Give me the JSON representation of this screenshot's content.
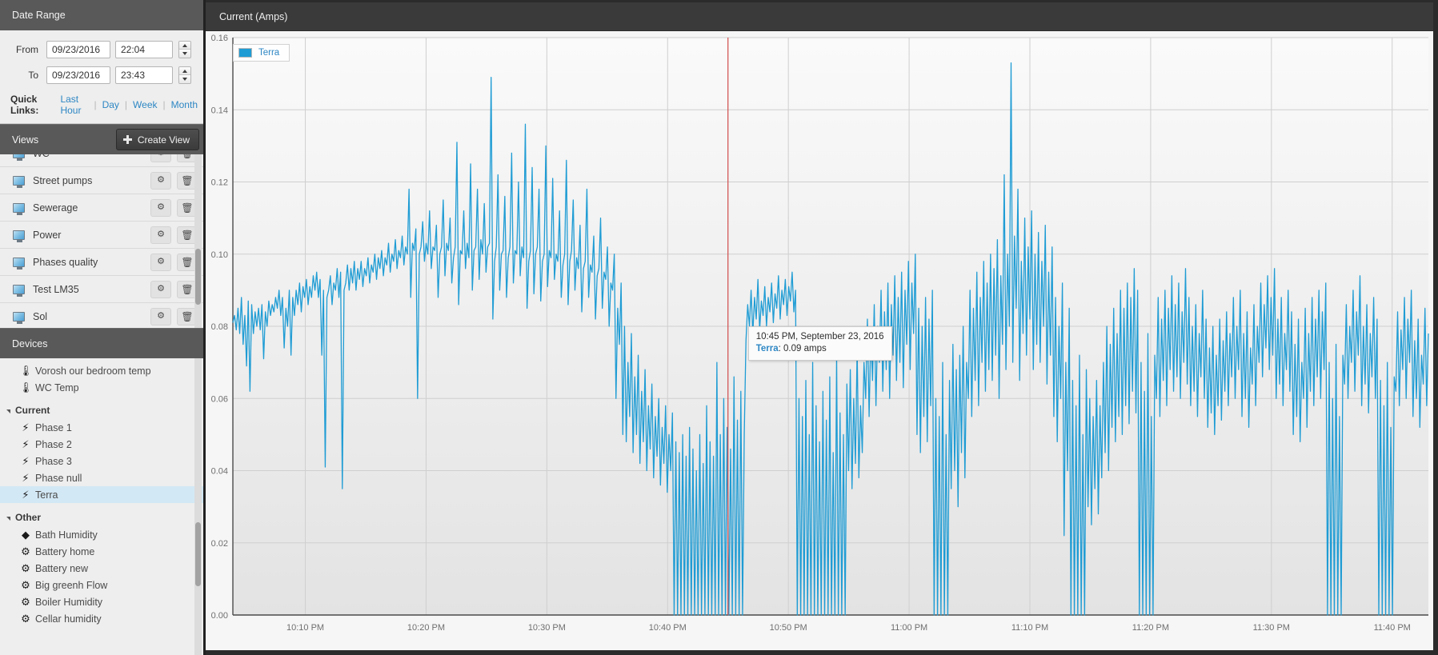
{
  "date_range": {
    "title": "Date Range",
    "from_label": "From",
    "to_label": "To",
    "from_date": "09/23/2016",
    "from_time": "22:04",
    "to_date": "09/23/2016",
    "to_time": "23:43",
    "quick_links_label": "Quick Links:",
    "quick_links": [
      "Last Hour",
      "Day",
      "Week",
      "Month"
    ]
  },
  "views": {
    "title": "Views",
    "create_button": "Create View",
    "create_icon": "plus-icon",
    "items": [
      {
        "name": "WC",
        "icon": "monitor-icon"
      },
      {
        "name": "Street pumps",
        "icon": "monitor-icon"
      },
      {
        "name": "Sewerage",
        "icon": "monitor-icon"
      },
      {
        "name": "Power",
        "icon": "monitor-icon"
      },
      {
        "name": "Phases quality",
        "icon": "monitor-icon"
      },
      {
        "name": "Test LM35",
        "icon": "monitor-icon"
      },
      {
        "name": "Sol",
        "icon": "monitor-icon"
      }
    ],
    "row_settings_icon": "gear-icon",
    "row_delete_icon": "trash-icon"
  },
  "devices": {
    "title": "Devices",
    "nodes": [
      {
        "type": "device",
        "label": "Vorosh our bedroom temp",
        "icon": "thermometer-icon",
        "glyph": "🌡",
        "selected": false
      },
      {
        "type": "device",
        "label": "WC Temp",
        "icon": "thermometer-icon",
        "glyph": "🌡",
        "selected": false
      },
      {
        "type": "group",
        "label": "Current",
        "icon": "collapse-triangle-icon"
      },
      {
        "type": "device",
        "label": "Phase 1",
        "icon": "bolt-icon",
        "glyph": "⚡",
        "selected": false
      },
      {
        "type": "device",
        "label": "Phase 2",
        "icon": "bolt-icon",
        "glyph": "⚡",
        "selected": false
      },
      {
        "type": "device",
        "label": "Phase 3",
        "icon": "bolt-icon",
        "glyph": "⚡",
        "selected": false
      },
      {
        "type": "device",
        "label": "Phase null",
        "icon": "bolt-icon",
        "glyph": "⚡",
        "selected": false
      },
      {
        "type": "device",
        "label": "Terra",
        "icon": "bolt-icon",
        "glyph": "⚡",
        "selected": true
      },
      {
        "type": "group",
        "label": "Other",
        "icon": "collapse-triangle-icon"
      },
      {
        "type": "device",
        "label": "Bath Humidity",
        "icon": "droplet-icon",
        "glyph": "◆",
        "selected": false
      },
      {
        "type": "device",
        "label": "Battery home",
        "icon": "gear-icon",
        "glyph": "⚙",
        "selected": false
      },
      {
        "type": "device",
        "label": "Battery new",
        "icon": "gear-icon",
        "glyph": "⚙",
        "selected": false
      },
      {
        "type": "device",
        "label": "Big greenh Flow",
        "icon": "gear-icon",
        "glyph": "⚙",
        "selected": false
      },
      {
        "type": "device",
        "label": "Boiler Humidity",
        "icon": "gear-icon",
        "glyph": "⚙",
        "selected": false
      },
      {
        "type": "device",
        "label": "Cellar humidity",
        "icon": "gear-icon",
        "glyph": "⚙",
        "selected": false
      }
    ]
  },
  "chart_panel": {
    "title": "Current (Amps)"
  },
  "tooltip": {
    "time": "10:45 PM, September 23, 2016",
    "series_name": "Terra",
    "value_text": ": 0.09 amps"
  },
  "chart_data": {
    "type": "line",
    "title": "Current (Amps)",
    "xlabel": "",
    "ylabel": "Current (Amps)",
    "grid": true,
    "legend_position": "top-left",
    "legend": [
      "Terra"
    ],
    "colors": {
      "series": "#1f9cd4",
      "cursor_line": "#d24b4b",
      "grid": "#cfcfcf"
    },
    "ylim": [
      0.0,
      0.16
    ],
    "yticks": [
      0.0,
      0.02,
      0.04,
      0.06,
      0.08,
      0.1,
      0.12,
      0.14,
      0.16
    ],
    "ytick_labels": [
      "0.00",
      "0.02",
      "0.04",
      "0.06",
      "0.08",
      "0.10",
      "0.12",
      "0.14",
      "0.16"
    ],
    "xlim_minutes": [
      1324,
      1423
    ],
    "xticks_minutes": [
      1330,
      1340,
      1350,
      1360,
      1370,
      1380,
      1390,
      1400,
      1410,
      1420
    ],
    "xtick_labels": [
      "10:10 PM",
      "10:20 PM",
      "10:30 PM",
      "10:40 PM",
      "10:50 PM",
      "11:00 PM",
      "11:10 PM",
      "11:20 PM",
      "11:30 PM",
      "11:40 PM"
    ],
    "cursor_minute": 1365,
    "highlight_point": {
      "minute": 1365,
      "value": 0.09
    },
    "series": [
      {
        "name": "Terra",
        "unit": "amps",
        "color": "#1f9cd4",
        "values": [
          0.081,
          0.083,
          0.079,
          0.085,
          0.078,
          0.088,
          0.075,
          0.083,
          0.069,
          0.087,
          0.062,
          0.086,
          0.078,
          0.084,
          0.08,
          0.085,
          0.079,
          0.086,
          0.071,
          0.084,
          0.08,
          0.087,
          0.083,
          0.086,
          0.084,
          0.088,
          0.085,
          0.09,
          0.083,
          0.088,
          0.074,
          0.085,
          0.08,
          0.09,
          0.072,
          0.088,
          0.083,
          0.09,
          0.086,
          0.092,
          0.084,
          0.091,
          0.088,
          0.093,
          0.086,
          0.091,
          0.088,
          0.094,
          0.09,
          0.095,
          0.088,
          0.093,
          0.072,
          0.09,
          0.041,
          0.088,
          0.09,
          0.094,
          0.086,
          0.092,
          0.09,
          0.096,
          0.088,
          0.095,
          0.035,
          0.09,
          0.092,
          0.097,
          0.09,
          0.096,
          0.092,
          0.098,
          0.09,
          0.096,
          0.093,
          0.098,
          0.091,
          0.096,
          0.094,
          0.099,
          0.092,
          0.097,
          0.095,
          0.1,
          0.093,
          0.099,
          0.096,
          0.101,
          0.094,
          0.099,
          0.097,
          0.103,
          0.095,
          0.1,
          0.098,
          0.104,
          0.096,
          0.101,
          0.099,
          0.105,
          0.097,
          0.102,
          0.1,
          0.118,
          0.088,
          0.103,
          0.101,
          0.107,
          0.06,
          0.1,
          0.102,
          0.109,
          0.098,
          0.103,
          0.1,
          0.112,
          0.096,
          0.102,
          0.101,
          0.108,
          0.088,
          0.1,
          0.102,
          0.115,
          0.094,
          0.103,
          0.101,
          0.11,
          0.092,
          0.099,
          0.102,
          0.131,
          0.086,
          0.101,
          0.1,
          0.112,
          0.096,
          0.103,
          0.099,
          0.125,
          0.09,
          0.101,
          0.102,
          0.118,
          0.093,
          0.104,
          0.1,
          0.114,
          0.095,
          0.102,
          0.103,
          0.149,
          0.082,
          0.098,
          0.102,
          0.122,
          0.09,
          0.1,
          0.101,
          0.116,
          0.088,
          0.099,
          0.102,
          0.128,
          0.092,
          0.101,
          0.1,
          0.12,
          0.094,
          0.102,
          0.099,
          0.136,
          0.085,
          0.098,
          0.101,
          0.124,
          0.089,
          0.1,
          0.102,
          0.118,
          0.087,
          0.098,
          0.1,
          0.13,
          0.091,
          0.101,
          0.099,
          0.121,
          0.093,
          0.1,
          0.098,
          0.112,
          0.088,
          0.097,
          0.1,
          0.126,
          0.086,
          0.098,
          0.101,
          0.115,
          0.09,
          0.099,
          0.096,
          0.108,
          0.084,
          0.096,
          0.098,
          0.118,
          0.088,
          0.097,
          0.095,
          0.105,
          0.082,
          0.094,
          0.096,
          0.11,
          0.085,
          0.095,
          0.093,
          0.102,
          0.08,
          0.092,
          0.09,
          0.1,
          0.06,
          0.085,
          0.075,
          0.092,
          0.05,
          0.08,
          0.048,
          0.07,
          0.055,
          0.078,
          0.045,
          0.066,
          0.05,
          0.072,
          0.042,
          0.062,
          0.048,
          0.068,
          0.04,
          0.058,
          0.046,
          0.064,
          0.038,
          0.055,
          0.044,
          0.06,
          0.036,
          0.052,
          0.042,
          0.058,
          0.034,
          0.05,
          0.04,
          0.056,
          0.0,
          0.048,
          0.0,
          0.045,
          0.0,
          0.05,
          0.0,
          0.044,
          0.0,
          0.052,
          0.0,
          0.046,
          0.0,
          0.04,
          0.0,
          0.05,
          0.0,
          0.042,
          0.0,
          0.058,
          0.0,
          0.048,
          0.0,
          0.044,
          0.0,
          0.07,
          0.0,
          0.05,
          0.0,
          0.06,
          0.0,
          0.052,
          0.0,
          0.046,
          0.0,
          0.066,
          0.0,
          0.054,
          0.0,
          0.062,
          0.0,
          0.05,
          0.076,
          0.086,
          0.08,
          0.09,
          0.078,
          0.088,
          0.082,
          0.093,
          0.079,
          0.087,
          0.083,
          0.091,
          0.08,
          0.088,
          0.084,
          0.092,
          0.081,
          0.089,
          0.085,
          0.094,
          0.082,
          0.09,
          0.086,
          0.093,
          0.083,
          0.091,
          0.087,
          0.095,
          0.084,
          0.09,
          0.0,
          0.06,
          0.0,
          0.055,
          0.0,
          0.065,
          0.0,
          0.05,
          0.0,
          0.07,
          0.0,
          0.058,
          0.0,
          0.048,
          0.0,
          0.062,
          0.0,
          0.054,
          0.0,
          0.066,
          0.0,
          0.045,
          0.0,
          0.072,
          0.0,
          0.056,
          0.0,
          0.05,
          0.0,
          0.064,
          0.04,
          0.068,
          0.035,
          0.06,
          0.042,
          0.074,
          0.038,
          0.058,
          0.045,
          0.07,
          0.06,
          0.082,
          0.055,
          0.078,
          0.065,
          0.086,
          0.058,
          0.08,
          0.07,
          0.09,
          0.062,
          0.084,
          0.068,
          0.092,
          0.06,
          0.086,
          0.072,
          0.094,
          0.065,
          0.088,
          0.07,
          0.095,
          0.063,
          0.09,
          0.075,
          0.098,
          0.068,
          0.092,
          0.078,
          0.1,
          0.05,
          0.085,
          0.045,
          0.08,
          0.055,
          0.088,
          0.048,
          0.082,
          0.058,
          0.09,
          0.0,
          0.06,
          0.0,
          0.055,
          0.0,
          0.07,
          0.0,
          0.05,
          0.0,
          0.065,
          0.035,
          0.075,
          0.04,
          0.068,
          0.03,
          0.072,
          0.045,
          0.08,
          0.038,
          0.07,
          0.06,
          0.09,
          0.055,
          0.085,
          0.065,
          0.095,
          0.058,
          0.088,
          0.07,
          0.098,
          0.062,
          0.092,
          0.068,
          0.1,
          0.065,
          0.096,
          0.072,
          0.104,
          0.06,
          0.094,
          0.075,
          0.122,
          0.068,
          0.1,
          0.08,
          0.153,
          0.07,
          0.105,
          0.085,
          0.118,
          0.065,
          0.098,
          0.078,
          0.11,
          0.072,
          0.102,
          0.082,
          0.112,
          0.068,
          0.1,
          0.075,
          0.106,
          0.07,
          0.098,
          0.08,
          0.108,
          0.064,
          0.095,
          0.072,
          0.102,
          0.055,
          0.088,
          0.048,
          0.08,
          0.06,
          0.092,
          0.022,
          0.07,
          0.04,
          0.085,
          0.0,
          0.065,
          0.0,
          0.058,
          0.0,
          0.072,
          0.0,
          0.05,
          0.0,
          0.068,
          0.03,
          0.06,
          0.025,
          0.055,
          0.035,
          0.065,
          0.028,
          0.058,
          0.038,
          0.07,
          0.045,
          0.08,
          0.04,
          0.075,
          0.052,
          0.085,
          0.048,
          0.078,
          0.055,
          0.09,
          0.05,
          0.085,
          0.058,
          0.092,
          0.053,
          0.088,
          0.062,
          0.096,
          0.056,
          0.09,
          0.0,
          0.07,
          0.0,
          0.062,
          0.0,
          0.078,
          0.0,
          0.055,
          0.0,
          0.072,
          0.06,
          0.088,
          0.055,
          0.082,
          0.065,
          0.09,
          0.058,
          0.085,
          0.068,
          0.094,
          0.062,
          0.086,
          0.066,
          0.092,
          0.06,
          0.084,
          0.07,
          0.096,
          0.064,
          0.088,
          0.058,
          0.08,
          0.062,
          0.086,
          0.055,
          0.078,
          0.066,
          0.09,
          0.06,
          0.082,
          0.052,
          0.074,
          0.056,
          0.08,
          0.05,
          0.072,
          0.058,
          0.082,
          0.054,
          0.076,
          0.062,
          0.084,
          0.058,
          0.078,
          0.066,
          0.088,
          0.06,
          0.08,
          0.068,
          0.09,
          0.055,
          0.078,
          0.06,
          0.084,
          0.052,
          0.074,
          0.064,
          0.086,
          0.058,
          0.08,
          0.07,
          0.092,
          0.066,
          0.086,
          0.074,
          0.094,
          0.068,
          0.088,
          0.072,
          0.096,
          0.06,
          0.082,
          0.064,
          0.088,
          0.058,
          0.078,
          0.068,
          0.09,
          0.062,
          0.084,
          0.05,
          0.075,
          0.055,
          0.082,
          0.048,
          0.07,
          0.06,
          0.085,
          0.052,
          0.078,
          0.062,
          0.088,
          0.058,
          0.082,
          0.066,
          0.09,
          0.06,
          0.084,
          0.068,
          0.092,
          0.0,
          0.07,
          0.0,
          0.06,
          0.0,
          0.075,
          0.0,
          0.055,
          0.0,
          0.072,
          0.064,
          0.086,
          0.06,
          0.08,
          0.07,
          0.09,
          0.062,
          0.084,
          0.072,
          0.094,
          0.058,
          0.08,
          0.064,
          0.086,
          0.056,
          0.078,
          0.066,
          0.088,
          0.06,
          0.082,
          0.0,
          0.065,
          0.0,
          0.058,
          0.0,
          0.07,
          0.0,
          0.052,
          0.0,
          0.066,
          0.062,
          0.084,
          0.058,
          0.079,
          0.068,
          0.088,
          0.06,
          0.082,
          0.07,
          0.09,
          0.055,
          0.076,
          0.06,
          0.082,
          0.052,
          0.072,
          0.064,
          0.085,
          0.058,
          0.078
        ]
      }
    ]
  }
}
